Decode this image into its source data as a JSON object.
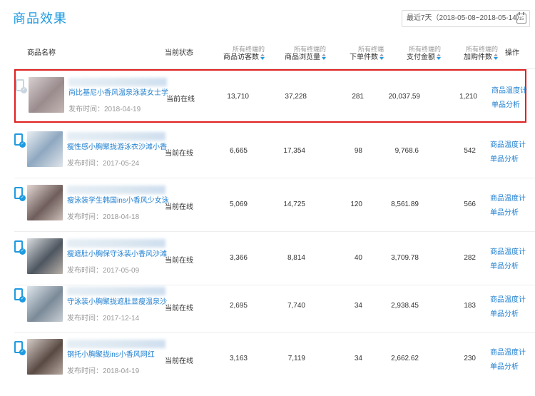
{
  "page": {
    "title": "商品效果"
  },
  "date_range": {
    "label": "最近7天（2018-05-08~2018-05-14）",
    "calendar_day": "15"
  },
  "table": {
    "columns": {
      "name": "商品名称",
      "status": "当前状态",
      "visitors": {
        "sub": "所有终端的",
        "main": "商品访客数"
      },
      "views": {
        "sub": "所有终端的",
        "main": "商品浏览量"
      },
      "orders": {
        "sub": "所有终端",
        "main": "下单件数"
      },
      "paid": {
        "sub": "所有终端的",
        "main": "支付金额"
      },
      "cart": {
        "sub": "所有终端的",
        "main": "加购件数"
      },
      "ops": "操作"
    },
    "rows": [
      {
        "title_tail": "时",
        "title": "尚比基尼小香风温泉泳装女士学",
        "publish": "发布时间：2018-04-19",
        "status": "当前在线",
        "visitors": "13,710",
        "views": "37,228",
        "orders": "281",
        "paid": "20,037.59",
        "cart": "1,210",
        "op1": "商品温度计",
        "op2": "单品分析"
      },
      {
        "title_tail": "遮肚显",
        "title": "瘦性感小胸聚拢游泳衣沙滩小香",
        "publish": "发布时间：2017-05-24",
        "status": "当前在线",
        "visitors": "6,665",
        "views": "17,354",
        "orders": "98",
        "paid": "9,768.6",
        "cart": "542",
        "op1": "商品温度计",
        "op2": "单品分析"
      },
      {
        "title_tail": "遮肚显",
        "title": "瘦泳装学生韩国ins小香风少女泳",
        "publish": "发布时间：2018-04-18",
        "status": "当前在线",
        "visitors": "5,069",
        "views": "14,725",
        "orders": "120",
        "paid": "8,561.89",
        "cart": "566",
        "op1": "商品温度计",
        "op2": "单品分析"
      },
      {
        "title_tail": "件套显",
        "title": "瘦遮肚小胸保守泳装小香风沙滩",
        "publish": "发布时间：2017-05-09",
        "status": "当前在线",
        "visitors": "3,366",
        "views": "8,814",
        "orders": "40",
        "paid": "3,709.78",
        "cart": "282",
        "op1": "商品温度计",
        "op2": "单品分析"
      },
      {
        "title_tail": "裙式保",
        "title": "守泳装小胸聚拢遮肚显瘦温泉沙",
        "publish": "发布时间：2017-12-14",
        "status": "当前在线",
        "visitors": "2,695",
        "views": "7,740",
        "orders": "34",
        "paid": "2,938.45",
        "cart": "183",
        "op1": "商品温度计",
        "op2": "单品分析"
      },
      {
        "title_tail": "基尼带",
        "title": "钢托小胸聚拢ins小香风网红",
        "publish": "发布时间：2018-04-19",
        "status": "当前在线",
        "visitors": "3,163",
        "views": "7,119",
        "orders": "34",
        "paid": "2,662.62",
        "cart": "230",
        "op1": "商品温度计",
        "op2": "单品分析"
      }
    ]
  },
  "icons": {
    "device": "mobile-check-icon",
    "calendar": "calendar-icon",
    "sort": "sort-icon"
  },
  "colors": {
    "accent": "#1f9be0",
    "link": "#1f7fd0",
    "highlight_border": "#e02020"
  }
}
